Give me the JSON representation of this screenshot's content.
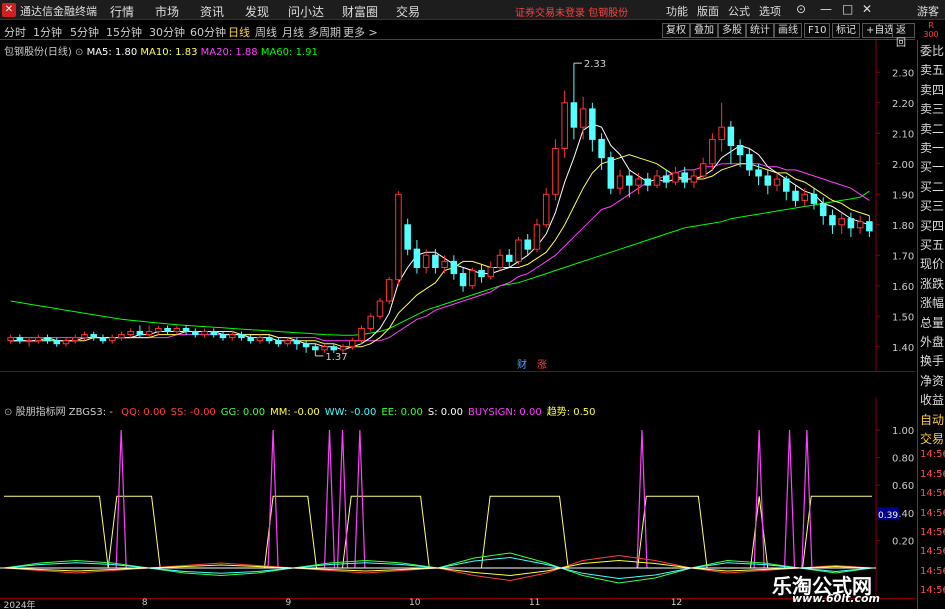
{
  "titlebar": {
    "app_title": "通达信金融终端",
    "menu": [
      "行情",
      "市场",
      "资讯",
      "发现",
      "问小达",
      "财富圈",
      "交易"
    ],
    "warning": "证券交易未登录  包钢股份",
    "right_menu": [
      "功能",
      "版面",
      "公式",
      "选项"
    ],
    "guest": "游客"
  },
  "periods": [
    {
      "label": "分时",
      "active": false
    },
    {
      "label": "1分钟",
      "active": false
    },
    {
      "label": "5分钟",
      "active": false
    },
    {
      "label": "15分钟",
      "active": false
    },
    {
      "label": "30分钟",
      "active": false
    },
    {
      "label": "60分钟",
      "active": false
    },
    {
      "label": "日线",
      "active": true
    },
    {
      "label": "周线",
      "active": false
    },
    {
      "label": "月线",
      "active": false
    },
    {
      "label": "多周期",
      "active": false
    },
    {
      "label": "更多 >",
      "active": false
    }
  ],
  "toolbar": [
    "复权",
    "叠加",
    "多股",
    "统计",
    "画线",
    "F10",
    "标记",
    "+自选",
    "返回"
  ],
  "corner": {
    "r": "R",
    "n": "300"
  },
  "main_legend": {
    "stock": "包钢股份(日线)",
    "ma5": "MA5: 1.80",
    "ma10": "MA10: 1.83",
    "ma20": "MA20: 1.88",
    "ma60": "MA60: 1.91"
  },
  "indicator_legend": {
    "name": "股朋指标网",
    "formula": "ZBGS3: -",
    "items": [
      {
        "text": "QQ: 0.00",
        "color": "#ff4040"
      },
      {
        "text": "SS: -0.00",
        "color": "#ff4040"
      },
      {
        "text": "GG: 0.00",
        "color": "#40ff40"
      },
      {
        "text": "MM: -0.00",
        "color": "#ffff40"
      },
      {
        "text": "WW: -0.00",
        "color": "#40ffff"
      },
      {
        "text": "EE: 0.00",
        "color": "#40ff40"
      },
      {
        "text": "S: 0.00",
        "color": "#ffffff"
      },
      {
        "text": "BUYSIGN: 0.00",
        "color": "#ff40ff"
      },
      {
        "text": "趋势: 0.50",
        "color": "#ffff40"
      }
    ]
  },
  "price_axis": [
    "2.30",
    "2.20",
    "2.10",
    "2.00",
    "1.90",
    "1.80",
    "1.70",
    "1.60",
    "1.50",
    "1.40"
  ],
  "ind_axis": [
    "1.00",
    "0.80",
    "0.60",
    "0.40",
    "0.20"
  ],
  "ind_value_box": "0.39",
  "price_labels": {
    "high": "2.33",
    "low": "1.37"
  },
  "events": {
    "cai": "财",
    "zhang": "涨"
  },
  "side_menu": [
    "委比",
    "卖五",
    "卖四",
    "卖三",
    "卖二",
    "卖一",
    "买一",
    "买二",
    "买三",
    "买四",
    "买五",
    "现价",
    "涨跌",
    "涨幅",
    "总量",
    "外盘",
    "换手",
    "净资",
    "收益",
    "自动",
    "交易",
    "14:56",
    "14:56",
    "14:56",
    "14:56",
    "14:56",
    "14:56",
    "14:56",
    "14:56"
  ],
  "x_labels": [
    {
      "text": "2024年",
      "pos": 0.004
    },
    {
      "text": "8",
      "pos": 0.155
    },
    {
      "text": "9",
      "pos": 0.312
    },
    {
      "text": "10",
      "pos": 0.447
    },
    {
      "text": "11",
      "pos": 0.578
    },
    {
      "text": "12",
      "pos": 0.733
    }
  ],
  "watermark": {
    "cn": "乐淘公式网",
    "url": "www.60lt.com"
  },
  "chart_data": {
    "type": "candlestick",
    "ylim": [
      1.35,
      2.36
    ],
    "colors": {
      "up": "#ff3232",
      "down": "#54ffff",
      "ma5": "#ffffff",
      "ma10": "#ffff50",
      "ma20": "#ff40ff",
      "ma60": "#00ff00"
    },
    "candles": [
      [
        1.42,
        1.43,
        1.41,
        1.44
      ],
      [
        1.43,
        1.42,
        1.41,
        1.44
      ],
      [
        1.42,
        1.42,
        1.4,
        1.43
      ],
      [
        1.42,
        1.43,
        1.41,
        1.44
      ],
      [
        1.43,
        1.42,
        1.41,
        1.44
      ],
      [
        1.42,
        1.41,
        1.4,
        1.43
      ],
      [
        1.41,
        1.42,
        1.4,
        1.43
      ],
      [
        1.42,
        1.43,
        1.41,
        1.44
      ],
      [
        1.43,
        1.44,
        1.42,
        1.45
      ],
      [
        1.44,
        1.43,
        1.42,
        1.45
      ],
      [
        1.43,
        1.42,
        1.41,
        1.44
      ],
      [
        1.42,
        1.43,
        1.41,
        1.44
      ],
      [
        1.43,
        1.44,
        1.42,
        1.45
      ],
      [
        1.44,
        1.45,
        1.43,
        1.46
      ],
      [
        1.45,
        1.44,
        1.43,
        1.47
      ],
      [
        1.44,
        1.45,
        1.43,
        1.47
      ],
      [
        1.45,
        1.46,
        1.44,
        1.47
      ],
      [
        1.46,
        1.45,
        1.44,
        1.47
      ],
      [
        1.45,
        1.46,
        1.44,
        1.47
      ],
      [
        1.46,
        1.45,
        1.44,
        1.47
      ],
      [
        1.45,
        1.44,
        1.43,
        1.46
      ],
      [
        1.44,
        1.45,
        1.43,
        1.46
      ],
      [
        1.45,
        1.44,
        1.43,
        1.46
      ],
      [
        1.44,
        1.43,
        1.42,
        1.45
      ],
      [
        1.43,
        1.44,
        1.42,
        1.45
      ],
      [
        1.44,
        1.43,
        1.42,
        1.45
      ],
      [
        1.43,
        1.42,
        1.41,
        1.44
      ],
      [
        1.42,
        1.43,
        1.41,
        1.44
      ],
      [
        1.43,
        1.42,
        1.41,
        1.44
      ],
      [
        1.42,
        1.41,
        1.4,
        1.43
      ],
      [
        1.41,
        1.42,
        1.4,
        1.43
      ],
      [
        1.42,
        1.41,
        1.39,
        1.43
      ],
      [
        1.41,
        1.4,
        1.38,
        1.42
      ],
      [
        1.4,
        1.39,
        1.37,
        1.41
      ],
      [
        1.39,
        1.4,
        1.38,
        1.41
      ],
      [
        1.4,
        1.39,
        1.38,
        1.41
      ],
      [
        1.39,
        1.4,
        1.38,
        1.41
      ],
      [
        1.4,
        1.42,
        1.39,
        1.43
      ],
      [
        1.42,
        1.46,
        1.41,
        1.47
      ],
      [
        1.46,
        1.5,
        1.45,
        1.51
      ],
      [
        1.5,
        1.55,
        1.49,
        1.56
      ],
      [
        1.55,
        1.62,
        1.54,
        1.63
      ],
      [
        1.62,
        1.9,
        1.6,
        1.91
      ],
      [
        1.8,
        1.72,
        1.7,
        1.82
      ],
      [
        1.72,
        1.66,
        1.64,
        1.75
      ],
      [
        1.66,
        1.7,
        1.64,
        1.72
      ],
      [
        1.7,
        1.66,
        1.64,
        1.72
      ],
      [
        1.66,
        1.68,
        1.64,
        1.7
      ],
      [
        1.68,
        1.64,
        1.62,
        1.7
      ],
      [
        1.64,
        1.6,
        1.58,
        1.66
      ],
      [
        1.6,
        1.65,
        1.59,
        1.66
      ],
      [
        1.65,
        1.63,
        1.61,
        1.67
      ],
      [
        1.63,
        1.66,
        1.62,
        1.68
      ],
      [
        1.66,
        1.7,
        1.65,
        1.72
      ],
      [
        1.7,
        1.68,
        1.66,
        1.72
      ],
      [
        1.68,
        1.75,
        1.67,
        1.76
      ],
      [
        1.75,
        1.72,
        1.7,
        1.77
      ],
      [
        1.72,
        1.8,
        1.71,
        1.82
      ],
      [
        1.8,
        1.9,
        1.79,
        1.92
      ],
      [
        1.9,
        2.05,
        1.88,
        2.08
      ],
      [
        2.05,
        2.2,
        2.02,
        2.24
      ],
      [
        2.2,
        2.12,
        2.08,
        2.33
      ],
      [
        2.12,
        2.18,
        2.08,
        2.22
      ],
      [
        2.18,
        2.08,
        2.04,
        2.2
      ],
      [
        2.08,
        2.02,
        1.98,
        2.1
      ],
      [
        2.02,
        1.92,
        1.9,
        2.04
      ],
      [
        1.92,
        1.96,
        1.9,
        1.98
      ],
      [
        1.96,
        1.93,
        1.89,
        1.98
      ],
      [
        1.93,
        1.95,
        1.9,
        1.97
      ],
      [
        1.95,
        1.93,
        1.91,
        1.97
      ],
      [
        1.93,
        1.96,
        1.92,
        1.98
      ],
      [
        1.96,
        1.94,
        1.92,
        1.98
      ],
      [
        1.94,
        1.97,
        1.93,
        1.99
      ],
      [
        1.97,
        1.94,
        1.92,
        1.99
      ],
      [
        1.94,
        1.96,
        1.92,
        1.98
      ],
      [
        1.96,
        2.0,
        1.95,
        2.02
      ],
      [
        2.0,
        2.08,
        1.98,
        2.1
      ],
      [
        2.08,
        2.12,
        2.04,
        2.2
      ],
      [
        2.12,
        2.06,
        2.0,
        2.14
      ],
      [
        2.06,
        2.03,
        1.99,
        2.08
      ],
      [
        2.03,
        1.98,
        1.96,
        2.05
      ],
      [
        1.98,
        1.96,
        1.93,
        2.0
      ],
      [
        1.96,
        1.93,
        1.9,
        1.98
      ],
      [
        1.93,
        1.95,
        1.91,
        1.97
      ],
      [
        1.95,
        1.91,
        1.88,
        1.96
      ],
      [
        1.91,
        1.88,
        1.86,
        1.93
      ],
      [
        1.88,
        1.9,
        1.86,
        1.92
      ],
      [
        1.9,
        1.87,
        1.85,
        1.92
      ],
      [
        1.87,
        1.83,
        1.8,
        1.89
      ],
      [
        1.83,
        1.8,
        1.77,
        1.85
      ],
      [
        1.8,
        1.82,
        1.77,
        1.84
      ],
      [
        1.82,
        1.79,
        1.76,
        1.84
      ],
      [
        1.79,
        1.81,
        1.77,
        1.83
      ],
      [
        1.81,
        1.78,
        1.76,
        1.83
      ]
    ],
    "ma5": [
      1.42,
      1.42,
      1.42,
      1.42,
      1.43,
      1.42,
      1.42,
      1.42,
      1.43,
      1.43,
      1.43,
      1.43,
      1.43,
      1.43,
      1.44,
      1.44,
      1.45,
      1.45,
      1.45,
      1.45,
      1.45,
      1.45,
      1.45,
      1.44,
      1.44,
      1.44,
      1.43,
      1.43,
      1.43,
      1.42,
      1.42,
      1.42,
      1.41,
      1.41,
      1.4,
      1.4,
      1.39,
      1.4,
      1.41,
      1.43,
      1.46,
      1.51,
      1.61,
      1.66,
      1.7,
      1.71,
      1.71,
      1.69,
      1.67,
      1.66,
      1.65,
      1.64,
      1.64,
      1.65,
      1.66,
      1.68,
      1.7,
      1.73,
      1.77,
      1.84,
      1.94,
      2.02,
      2.11,
      2.13,
      2.12,
      2.06,
      2.03,
      1.98,
      1.96,
      1.94,
      1.95,
      1.94,
      1.95,
      1.95,
      1.95,
      1.96,
      1.98,
      2.02,
      2.04,
      2.06,
      2.05,
      2.03,
      1.99,
      1.97,
      1.95,
      1.93,
      1.91,
      1.9,
      1.87,
      1.86,
      1.84,
      1.82,
      1.81,
      1.8
    ],
    "ma10": [
      1.42,
      1.42,
      1.42,
      1.42,
      1.42,
      1.42,
      1.42,
      1.42,
      1.42,
      1.43,
      1.43,
      1.43,
      1.43,
      1.43,
      1.43,
      1.43,
      1.44,
      1.44,
      1.44,
      1.45,
      1.45,
      1.45,
      1.45,
      1.45,
      1.45,
      1.44,
      1.44,
      1.44,
      1.44,
      1.43,
      1.43,
      1.42,
      1.42,
      1.42,
      1.41,
      1.41,
      1.4,
      1.4,
      1.4,
      1.41,
      1.43,
      1.46,
      1.51,
      1.54,
      1.57,
      1.59,
      1.61,
      1.65,
      1.66,
      1.68,
      1.68,
      1.67,
      1.66,
      1.66,
      1.66,
      1.66,
      1.67,
      1.69,
      1.71,
      1.75,
      1.8,
      1.86,
      1.92,
      1.97,
      2.0,
      2.01,
      2.02,
      2.03,
      2.02,
      2.01,
      2.0,
      1.98,
      1.96,
      1.95,
      1.95,
      1.95,
      1.96,
      1.98,
      1.99,
      2.0,
      2.0,
      1.99,
      1.98,
      1.97,
      1.97,
      1.95,
      1.94,
      1.92,
      1.9,
      1.88,
      1.87,
      1.85,
      1.84,
      1.83
    ],
    "ma20": [
      1.43,
      1.43,
      1.43,
      1.43,
      1.43,
      1.43,
      1.43,
      1.43,
      1.43,
      1.43,
      1.43,
      1.43,
      1.43,
      1.43,
      1.43,
      1.43,
      1.43,
      1.43,
      1.44,
      1.44,
      1.44,
      1.44,
      1.44,
      1.44,
      1.44,
      1.44,
      1.44,
      1.44,
      1.44,
      1.43,
      1.43,
      1.43,
      1.43,
      1.43,
      1.42,
      1.42,
      1.42,
      1.42,
      1.42,
      1.42,
      1.42,
      1.43,
      1.45,
      1.47,
      1.49,
      1.5,
      1.52,
      1.53,
      1.54,
      1.55,
      1.56,
      1.57,
      1.58,
      1.6,
      1.61,
      1.63,
      1.64,
      1.66,
      1.68,
      1.7,
      1.73,
      1.76,
      1.79,
      1.82,
      1.85,
      1.86,
      1.88,
      1.9,
      1.92,
      1.94,
      1.95,
      1.96,
      1.97,
      1.98,
      1.98,
      1.99,
      1.99,
      2.0,
      2.0,
      2.0,
      2.0,
      2.0,
      1.99,
      1.99,
      1.98,
      1.98,
      1.97,
      1.96,
      1.95,
      1.94,
      1.93,
      1.92,
      1.9,
      1.88
    ],
    "ma60": [
      1.55,
      1.545,
      1.54,
      1.535,
      1.53,
      1.525,
      1.52,
      1.515,
      1.51,
      1.505,
      1.5,
      1.495,
      1.49,
      1.487,
      1.484,
      1.481,
      1.478,
      1.475,
      1.472,
      1.47,
      1.468,
      1.466,
      1.464,
      1.462,
      1.46,
      1.458,
      1.456,
      1.454,
      1.452,
      1.45,
      1.448,
      1.446,
      1.444,
      1.442,
      1.44,
      1.439,
      1.438,
      1.438,
      1.44,
      1.445,
      1.45,
      1.46,
      1.475,
      1.49,
      1.505,
      1.52,
      1.53,
      1.54,
      1.55,
      1.56,
      1.57,
      1.58,
      1.59,
      1.6,
      1.605,
      1.61,
      1.62,
      1.63,
      1.64,
      1.65,
      1.66,
      1.67,
      1.68,
      1.69,
      1.7,
      1.71,
      1.72,
      1.73,
      1.74,
      1.75,
      1.76,
      1.77,
      1.78,
      1.79,
      1.795,
      1.8,
      1.805,
      1.81,
      1.82,
      1.825,
      1.83,
      1.835,
      1.84,
      1.845,
      1.85,
      1.855,
      1.86,
      1.865,
      1.87,
      1.875,
      1.88,
      1.885,
      1.89,
      1.91
    ]
  },
  "indicator_data": {
    "ylim": [
      0,
      1.08
    ],
    "trend_yellow": [
      [
        0,
        0.52
      ],
      [
        0.11,
        0.52
      ],
      [
        0.12,
        0
      ],
      [
        0.13,
        0.52
      ],
      [
        0.17,
        0.52
      ],
      [
        0.18,
        0
      ],
      [
        0.3,
        0
      ],
      [
        0.31,
        0.52
      ],
      [
        0.35,
        0.52
      ],
      [
        0.36,
        0
      ],
      [
        0.39,
        0
      ],
      [
        0.4,
        0.52
      ],
      [
        0.48,
        0.52
      ],
      [
        0.49,
        0
      ],
      [
        0.55,
        0
      ],
      [
        0.56,
        0.52
      ],
      [
        0.64,
        0.52
      ],
      [
        0.65,
        0
      ],
      [
        0.73,
        0
      ],
      [
        0.74,
        0.52
      ],
      [
        0.8,
        0.52
      ],
      [
        0.81,
        0
      ],
      [
        0.86,
        0
      ],
      [
        0.87,
        0.52
      ],
      [
        0.88,
        0
      ],
      [
        0.92,
        0
      ],
      [
        0.93,
        0.52
      ],
      [
        1.0,
        0.52
      ]
    ],
    "buysign_spikes": [
      0.135,
      0.31,
      0.375,
      0.39,
      0.41,
      0.735,
      0.87,
      0.905,
      0.925
    ],
    "wave_a": [
      0.0,
      0.02,
      0.03,
      0.02,
      0.0,
      -0.02,
      -0.03,
      -0.02,
      0.0,
      0.02,
      0.03,
      0.02,
      0.0,
      0.04,
      0.06,
      0.02,
      -0.03,
      -0.06,
      -0.04,
      0.0,
      0.03,
      0.02,
      0.0,
      -0.02,
      0.0
    ],
    "wave_b": [
      0.0,
      -0.01,
      -0.02,
      -0.01,
      0.0,
      0.01,
      0.02,
      0.01,
      0.0,
      -0.01,
      -0.02,
      -0.01,
      0.0,
      -0.03,
      -0.05,
      -0.02,
      0.03,
      0.05,
      0.03,
      0.0,
      -0.02,
      -0.01,
      0.0,
      0.01,
      0.0
    ]
  }
}
